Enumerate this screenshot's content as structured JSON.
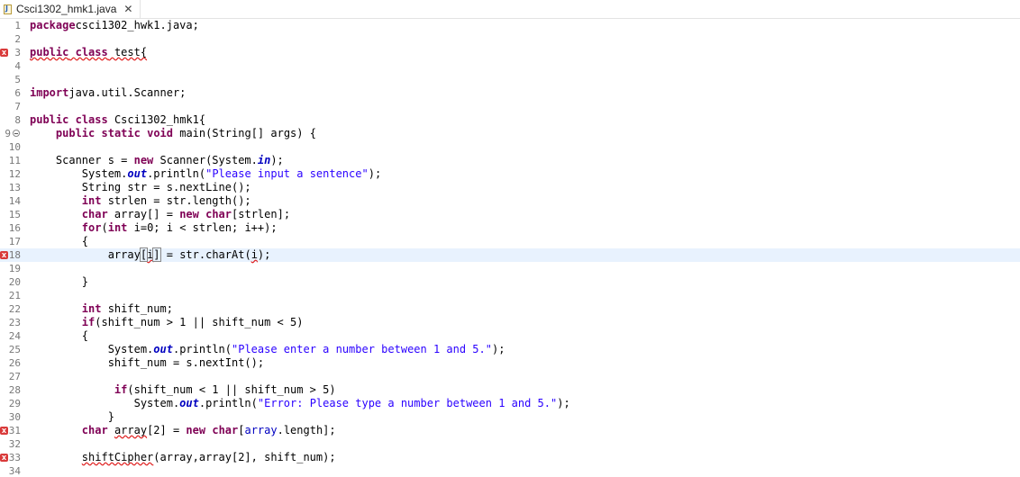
{
  "tab": {
    "icon": "java-file-icon",
    "label": "Csci1302_hmk1.java",
    "close_icon": "close-icon"
  },
  "colors": {
    "keyword": "#7f0055",
    "string": "#2a00ff",
    "field": "#0000c0",
    "current_line": "#e8f2fe",
    "error": "#d93a3a"
  },
  "editor": {
    "current_line": 18,
    "lines": [
      {
        "n": "1",
        "marker": "",
        "segs": [
          [
            "kw",
            "package"
          ],
          [
            "",
            "csci1302_hwk1.java;"
          ]
        ]
      },
      {
        "n": "2",
        "marker": "",
        "segs": []
      },
      {
        "n": "3",
        "marker": "error",
        "segs": [
          [
            "kw err",
            "public"
          ],
          [
            "err",
            " "
          ],
          [
            "kw err",
            "class"
          ],
          [
            "err",
            " test{"
          ]
        ]
      },
      {
        "n": "4",
        "marker": "",
        "segs": []
      },
      {
        "n": "5",
        "marker": "",
        "segs": []
      },
      {
        "n": "6",
        "marker": "",
        "segs": [
          [
            "kw",
            "import"
          ],
          [
            "",
            "java.util.Scanner;"
          ]
        ]
      },
      {
        "n": "7",
        "marker": "",
        "segs": []
      },
      {
        "n": "8",
        "marker": "",
        "segs": [
          [
            "kw",
            "public"
          ],
          [
            "",
            " "
          ],
          [
            "kw",
            "class"
          ],
          [
            "",
            " Csci1302_hmk1{"
          ]
        ]
      },
      {
        "n": "9",
        "marker": "fold",
        "segs": [
          [
            "",
            "    "
          ],
          [
            "kw",
            "public"
          ],
          [
            "",
            " "
          ],
          [
            "kw",
            "static"
          ],
          [
            "",
            " "
          ],
          [
            "kw",
            "void"
          ],
          [
            "",
            " main(String[] "
          ],
          [
            "",
            "args) {"
          ]
        ]
      },
      {
        "n": "10",
        "marker": "",
        "segs": []
      },
      {
        "n": "11",
        "marker": "",
        "segs": [
          [
            "",
            "    Scanner s = "
          ],
          [
            "kw",
            "new"
          ],
          [
            "",
            " Scanner(System."
          ],
          [
            "sf",
            "in"
          ],
          [
            "",
            ");"
          ]
        ]
      },
      {
        "n": "12",
        "marker": "",
        "segs": [
          [
            "",
            "        System."
          ],
          [
            "sf",
            "out"
          ],
          [
            "",
            ".println("
          ],
          [
            "str",
            "\"Please input a sentence\""
          ],
          [
            "",
            ");"
          ]
        ]
      },
      {
        "n": "13",
        "marker": "",
        "segs": [
          [
            "",
            "        String str = s.nextLine();"
          ]
        ]
      },
      {
        "n": "14",
        "marker": "",
        "segs": [
          [
            "",
            "        "
          ],
          [
            "kw",
            "int"
          ],
          [
            "",
            " strlen = str.length();"
          ]
        ]
      },
      {
        "n": "15",
        "marker": "",
        "segs": [
          [
            "",
            "        "
          ],
          [
            "kw",
            "char"
          ],
          [
            "",
            " array[] = "
          ],
          [
            "kw",
            "new"
          ],
          [
            "",
            " "
          ],
          [
            "kw",
            "char"
          ],
          [
            "",
            "[strlen];"
          ]
        ]
      },
      {
        "n": "16",
        "marker": "",
        "segs": [
          [
            "",
            "        "
          ],
          [
            "kw",
            "for"
          ],
          [
            "",
            "("
          ],
          [
            "kw",
            "int"
          ],
          [
            "",
            " i=0; i < strlen; i++);"
          ]
        ]
      },
      {
        "n": "17",
        "marker": "",
        "segs": [
          [
            "",
            "        {"
          ]
        ]
      },
      {
        "n": "18",
        "marker": "error",
        "segs": [
          [
            "",
            "            array"
          ],
          [
            "bracket",
            "["
          ],
          [
            "err",
            "i"
          ],
          [
            "bracket",
            "]"
          ],
          [
            "",
            " = str.charAt("
          ],
          [
            "err",
            "i"
          ],
          [
            "",
            ");"
          ]
        ]
      },
      {
        "n": "19",
        "marker": "",
        "segs": []
      },
      {
        "n": "20",
        "marker": "",
        "segs": [
          [
            "",
            "        }"
          ]
        ]
      },
      {
        "n": "21",
        "marker": "",
        "segs": []
      },
      {
        "n": "22",
        "marker": "",
        "segs": [
          [
            "",
            "        "
          ],
          [
            "kw",
            "int"
          ],
          [
            "",
            " shift_num;"
          ]
        ]
      },
      {
        "n": "23",
        "marker": "",
        "segs": [
          [
            "",
            "        "
          ],
          [
            "kw",
            "if"
          ],
          [
            "",
            "(shift_num > 1 || shift_num < 5)"
          ]
        ]
      },
      {
        "n": "24",
        "marker": "",
        "segs": [
          [
            "",
            "        {"
          ]
        ]
      },
      {
        "n": "25",
        "marker": "",
        "segs": [
          [
            "",
            "            System."
          ],
          [
            "sf",
            "out"
          ],
          [
            "",
            ".println("
          ],
          [
            "str",
            "\"Please enter a number between 1 and 5.\""
          ],
          [
            "",
            ");"
          ]
        ]
      },
      {
        "n": "26",
        "marker": "",
        "segs": [
          [
            "",
            "            shift_num = s.nextInt();"
          ]
        ]
      },
      {
        "n": "27",
        "marker": "",
        "segs": []
      },
      {
        "n": "28",
        "marker": "",
        "segs": [
          [
            "",
            "             "
          ],
          [
            "kw",
            "if"
          ],
          [
            "",
            "(shift_num < 1 || shift_num > 5)"
          ]
        ]
      },
      {
        "n": "29",
        "marker": "",
        "segs": [
          [
            "",
            "                System."
          ],
          [
            "sf",
            "out"
          ],
          [
            "",
            ".println("
          ],
          [
            "str",
            "\"Error: Please type a number between 1 and 5.\""
          ],
          [
            "",
            ");"
          ]
        ]
      },
      {
        "n": "30",
        "marker": "",
        "segs": [
          [
            "",
            "            }"
          ]
        ]
      },
      {
        "n": "31",
        "marker": "error",
        "segs": [
          [
            "",
            "        "
          ],
          [
            "kw",
            "char"
          ],
          [
            "",
            " "
          ],
          [
            "err",
            "array"
          ],
          [
            "",
            "[2] = "
          ],
          [
            "kw",
            "new"
          ],
          [
            "",
            " "
          ],
          [
            "kw",
            "char"
          ],
          [
            "",
            "["
          ],
          [
            "fld",
            "array"
          ],
          [
            "",
            ".length];"
          ]
        ]
      },
      {
        "n": "32",
        "marker": "",
        "segs": []
      },
      {
        "n": "33",
        "marker": "error",
        "segs": [
          [
            "",
            "        "
          ],
          [
            "err",
            "shiftCipher"
          ],
          [
            "",
            "(array,array[2], shift_num);"
          ]
        ]
      },
      {
        "n": "34",
        "marker": "",
        "segs": []
      }
    ]
  }
}
